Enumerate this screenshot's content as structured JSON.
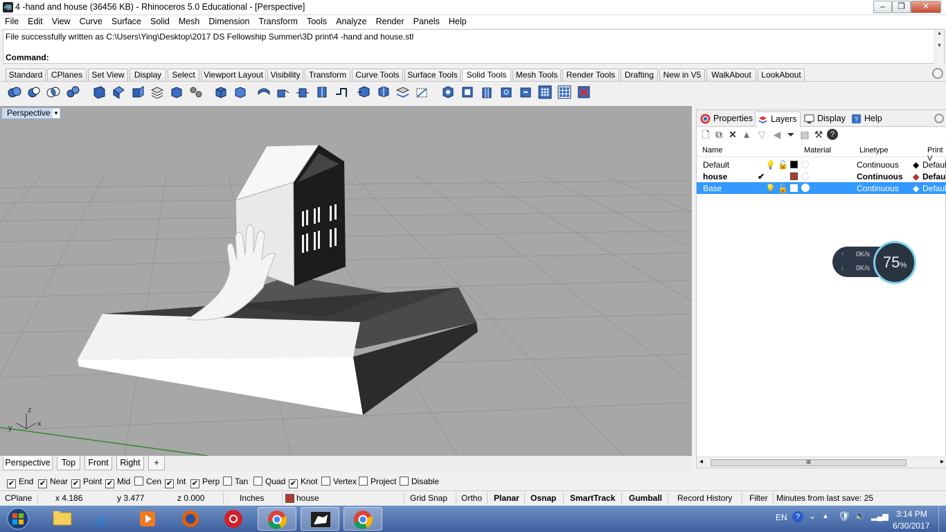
{
  "window": {
    "title": "4 -hand and house (36456 KB) - Rhinoceros 5.0 Educational - [Perspective]",
    "minimize": "–",
    "maximize": "❐",
    "close": "✕"
  },
  "menu": [
    "File",
    "Edit",
    "View",
    "Curve",
    "Surface",
    "Solid",
    "Mesh",
    "Dimension",
    "Transform",
    "Tools",
    "Analyze",
    "Render",
    "Panels",
    "Help"
  ],
  "command": {
    "history": "File successfully written as C:\\Users\\Ying\\Desktop\\2017 DS Fellowship Summer\\3D print\\4 -hand and house.stl",
    "prompt": "Command:",
    "value": ""
  },
  "toolbar_tabs": [
    "Standard",
    "CPlanes",
    "Set View",
    "Display",
    "Select",
    "Viewport Layout",
    "Visibility",
    "Transform",
    "Curve Tools",
    "Surface Tools",
    "Solid Tools",
    "Mesh Tools",
    "Render Tools",
    "Drafting",
    "New in V5",
    "WalkAbout",
    "LookAbout"
  ],
  "active_toolbar_tab": "Solid Tools",
  "viewport": {
    "label": "Perspective",
    "dropdown": "▼",
    "axes": {
      "z": "z",
      "y": "y",
      "x": "x"
    },
    "tabs": [
      "Perspective",
      "Top",
      "Front",
      "Right"
    ],
    "add_tab": "+"
  },
  "osnaps": [
    {
      "label": "End",
      "checked": true
    },
    {
      "label": "Near",
      "checked": true
    },
    {
      "label": "Point",
      "checked": true
    },
    {
      "label": "Mid",
      "checked": true
    },
    {
      "label": "Cen",
      "checked": false
    },
    {
      "label": "Int",
      "checked": true
    },
    {
      "label": "Perp",
      "checked": true
    },
    {
      "label": "Tan",
      "checked": false
    },
    {
      "label": "Quad",
      "checked": false
    },
    {
      "label": "Knot",
      "checked": true
    },
    {
      "label": "Vertex",
      "checked": false
    },
    {
      "label": "Project",
      "checked": false
    },
    {
      "label": "Disable",
      "checked": false
    }
  ],
  "status": {
    "cplane": "CPlane",
    "x": "x 4.186",
    "y": "y 3.477",
    "z": "z 0.000",
    "units": "Inches",
    "layer": "house",
    "layer_color": "#b03a2e",
    "grid_snap": "Grid Snap",
    "ortho": "Ortho",
    "planar": "Planar",
    "osnap": "Osnap",
    "smarttrack": "SmartTrack",
    "gumball": "Gumball",
    "record_history": "Record History",
    "filter": "Filter",
    "save_info": "Minutes from last save: 25"
  },
  "panel": {
    "tabs": [
      "Properties",
      "Layers",
      "Display",
      "Help"
    ],
    "active_tab": "Layers",
    "columns": {
      "name": "Name",
      "material": "Material",
      "linetype": "Linetype",
      "print": "Print V"
    },
    "layers": [
      {
        "name": "Default",
        "current": "",
        "color": "#000000",
        "linetype": "Continuous",
        "print": "Defaul",
        "bold": false,
        "selected": false
      },
      {
        "name": "house",
        "current": "✔",
        "color": "#b03a2e",
        "linetype": "Continuous",
        "print": "Defau",
        "bold": true,
        "selected": false
      },
      {
        "name": "Base",
        "current": "",
        "color": "#ffffff",
        "linetype": "Continuous",
        "print": "Defaul",
        "bold": false,
        "selected": true
      }
    ],
    "scroll_grip": "III",
    "scroll_left": "◂",
    "scroll_right": "▸"
  },
  "network_widget": {
    "up": "0K/s",
    "down": "0K/s",
    "percent": "75",
    "percent_unit": "%"
  },
  "taskbar": {
    "language": "EN",
    "time": "3:14 PM",
    "date": "6/30/2017"
  }
}
